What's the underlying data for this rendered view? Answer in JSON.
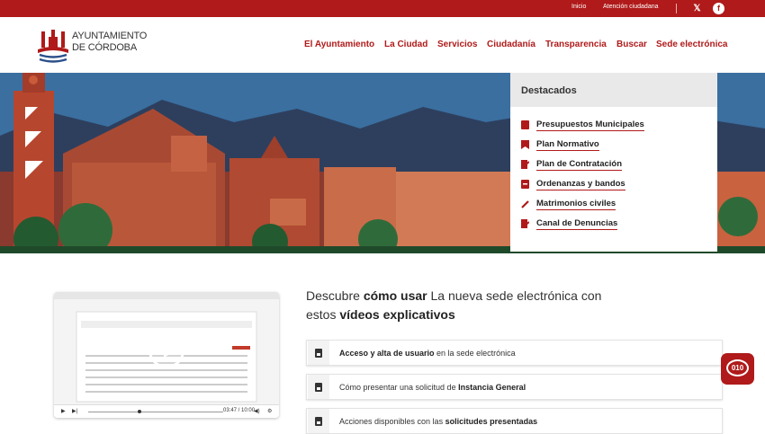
{
  "topbar": {
    "links": [
      "Inicio",
      "Atención ciudadana"
    ],
    "social": [
      {
        "name": "x-icon",
        "glyph": "𝕏"
      },
      {
        "name": "facebook-icon",
        "glyph": "f"
      }
    ]
  },
  "header": {
    "logo_line1": "AYUNTAMIENTO",
    "logo_line2": "DE CÓRDOBA",
    "nav": [
      "El Ayuntamiento",
      "La Ciudad",
      "Servicios",
      "Ciudadanía",
      "Transparencia",
      "Buscar",
      "Sede electrónica"
    ]
  },
  "destacados": {
    "title": "Destacados",
    "items": [
      {
        "label": "Presupuestos Municipales",
        "icon": "document-icon"
      },
      {
        "label": "Plan Normativo",
        "icon": "bookmark-icon"
      },
      {
        "label": "Plan de Contratación",
        "icon": "signature-icon"
      },
      {
        "label": "Ordenanzas y bandos",
        "icon": "archive-icon"
      },
      {
        "label": "Matrimonios civiles",
        "icon": "pen-icon"
      },
      {
        "label": "Canal de Denuncias",
        "icon": "edit-icon"
      }
    ]
  },
  "video": {
    "time": "03:47 / 10:00",
    "progress": 0.38
  },
  "intro": {
    "p1": "Descubre ",
    "b1": "cómo usar",
    "p2": " La nueva sede electrónica con estos ",
    "b2": "vídeos explicativos"
  },
  "cards": [
    {
      "bold_first": true,
      "bold": "Acceso y alta de usuario",
      "text": " en la sede electrónica"
    },
    {
      "bold_first": false,
      "text": "Cómo presentar una solicitud de ",
      "bold": "Instancia General"
    },
    {
      "bold_first": false,
      "text": "Acciones disponibles con las ",
      "bold": "solicitudes presentadas"
    }
  ],
  "chat": {
    "label": "010"
  },
  "colors": {
    "brand": "#b01a1a",
    "sky": "#3a6fa0",
    "mountains": "#2e3f5e"
  }
}
